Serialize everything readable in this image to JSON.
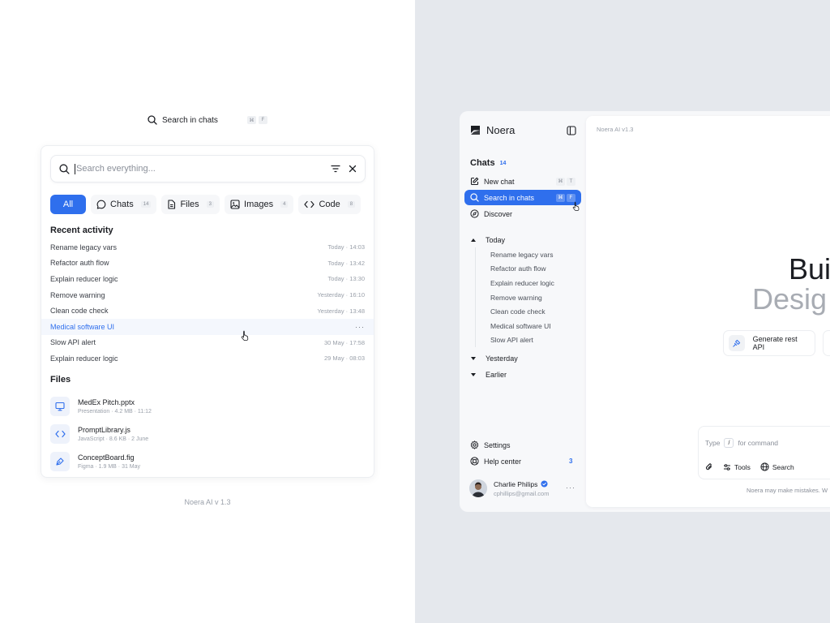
{
  "left": {
    "trigger": {
      "label": "Search in chats",
      "shortcut": [
        "⌘",
        "F"
      ]
    },
    "search": {
      "placeholder": "Search everything..."
    },
    "tabs": [
      {
        "label": "All"
      },
      {
        "label": "Chats",
        "count": "14"
      },
      {
        "label": "Files",
        "count": "3"
      },
      {
        "label": "Images",
        "count": "4"
      },
      {
        "label": "Code",
        "count": "8"
      }
    ],
    "recent_title": "Recent activity",
    "recent": [
      {
        "title": "Rename legacy vars",
        "time": "Today · 14:03"
      },
      {
        "title": "Refactor auth flow",
        "time": "Today · 13:42"
      },
      {
        "title": "Explain reducer logic",
        "time": "Today · 13:30"
      },
      {
        "title": "Remove warning",
        "time": "Yesterday · 16:10"
      },
      {
        "title": "Clean code check",
        "time": "Yesterday · 13:48"
      },
      {
        "title": "Medical software UI",
        "more": "···"
      },
      {
        "title": "Slow API alert",
        "time": "30 May · 17:58"
      },
      {
        "title": "Explain reducer logic",
        "time": "29 May · 08:03"
      }
    ],
    "files_title": "Files",
    "files": [
      {
        "name": "MedEx Pitch.pptx",
        "meta": "Presentation · 4.2 MB · 11:12",
        "icon": "presentation-icon"
      },
      {
        "name": "PromptLibrary.js",
        "meta": "JavaScript · 8.6 KB · 2 June",
        "icon": "code-icon"
      },
      {
        "name": "ConceptBoard.fig",
        "meta": "Figma · 1.9 MB · 31 May",
        "icon": "pen-tool-icon"
      }
    ],
    "version": "Noera AI v 1.3"
  },
  "app": {
    "brand": "Noera",
    "chats_label": "Chats",
    "chats_count": "14",
    "nav": [
      {
        "label": "New chat",
        "shortcut": [
          "⌘",
          "T"
        ]
      },
      {
        "label": "Search in chats",
        "shortcut": [
          "⌘",
          "F"
        ]
      },
      {
        "label": "Discover"
      }
    ],
    "groups": {
      "today": "Today",
      "yesterday": "Yesterday",
      "earlier": "Earlier"
    },
    "today_items": [
      "Rename legacy vars",
      "Refactor auth flow",
      "Explain reducer logic",
      "Remove warning",
      "Clean code check",
      "Medical software UI",
      "Slow API alert"
    ],
    "settings": "Settings",
    "help": "Help center",
    "help_count": "3",
    "user": {
      "name": "Charlie Philips",
      "email": "cphillips@gmail.com",
      "more": "···"
    },
    "main": {
      "version": "Noera AI v1.3",
      "hero_line1": "Bui",
      "hero_line2": "Desig",
      "suggestion": "Generate rest API",
      "composer": {
        "type": "Type",
        "slash": "/",
        "for_command": "for command",
        "tools": "Tools",
        "search": "Search"
      },
      "disclaimer": "Noera may make mistakes. W"
    }
  },
  "colors": {
    "accent": "#2f6fed",
    "right_bg": "#e5e8ed",
    "muted": "#9aa0aa"
  }
}
